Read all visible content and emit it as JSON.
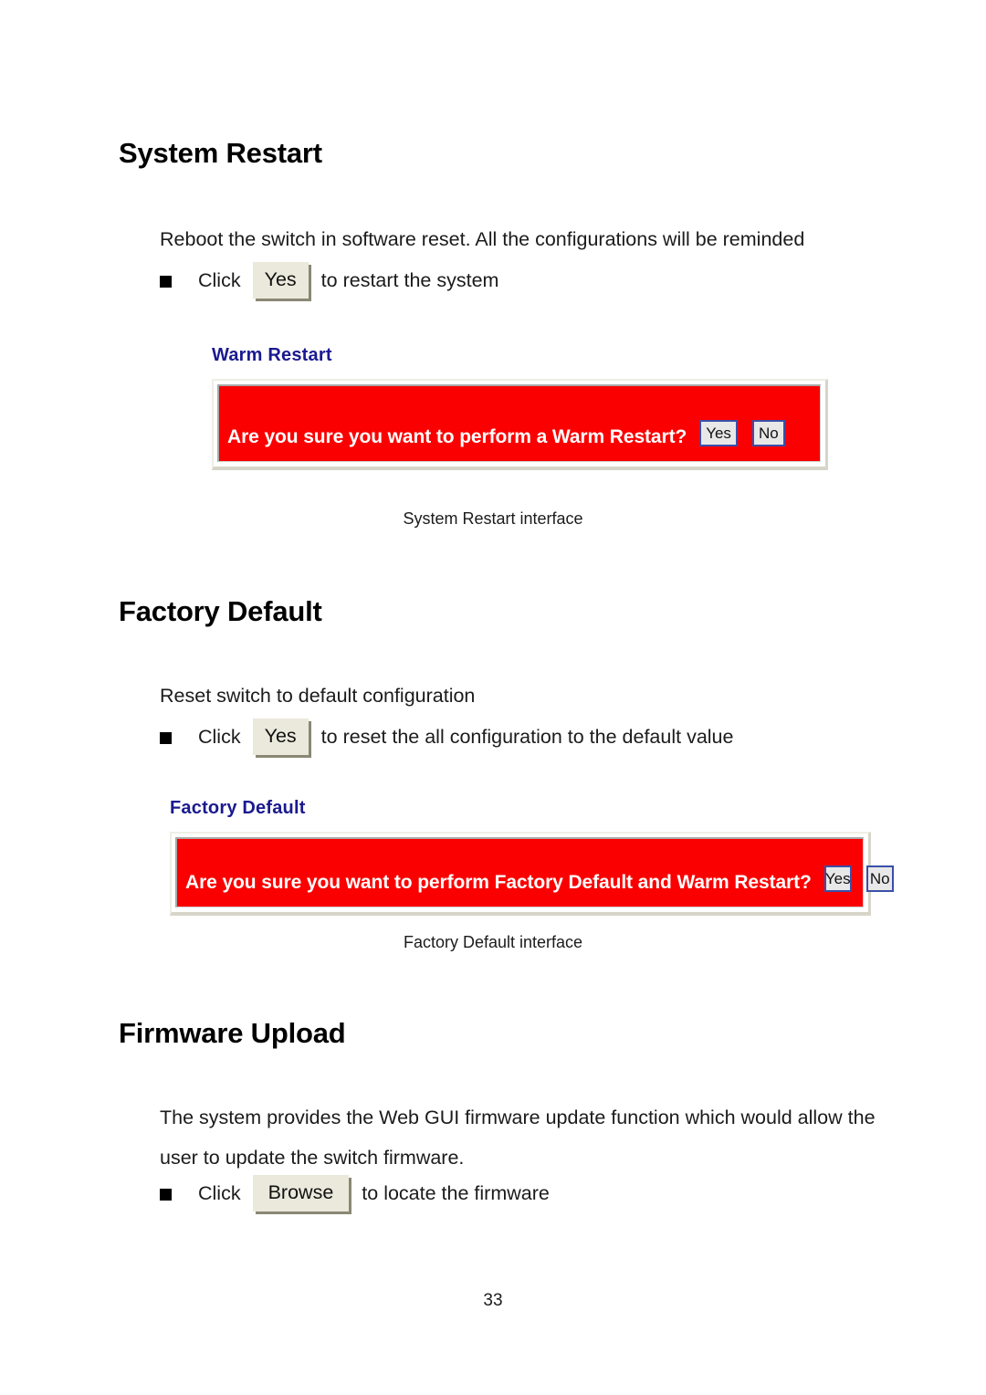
{
  "page": {
    "number": "33"
  },
  "sections": [
    {
      "heading": "System Restart",
      "intro": "Reboot the switch in software reset. All the configurations will be reminded",
      "bullet": {
        "lead": "Click",
        "button_label": "Yes",
        "trail": "to restart the system"
      },
      "screenshot": {
        "title": "Warm Restart",
        "question": "Are you sure you want to perform a Warm Restart?",
        "yes_label": "Yes",
        "no_label": "No",
        "banner_color": "#fb0000",
        "title_color": "#1a1a8f"
      },
      "caption": "System Restart interface"
    },
    {
      "heading": "Factory Default",
      "intro": "Reset switch to default configuration",
      "bullet": {
        "lead": "Click",
        "button_label": "Yes",
        "trail": "to reset the all configuration to the default value"
      },
      "screenshot": {
        "title": "Factory Default",
        "question": "Are you sure you want to perform Factory Default and Warm Restart?",
        "yes_label": "Yes",
        "no_label": "No",
        "banner_color": "#fb0000",
        "title_color": "#1a1a8f"
      },
      "caption": "Factory Default interface"
    },
    {
      "heading": "Firmware Upload",
      "intro": "The system provides the Web GUI firmware update function which would allow the user to update the switch firmware.",
      "bullet": {
        "lead": "Click",
        "button_label": "Browse",
        "trail": "to locate the firmware"
      }
    }
  ]
}
